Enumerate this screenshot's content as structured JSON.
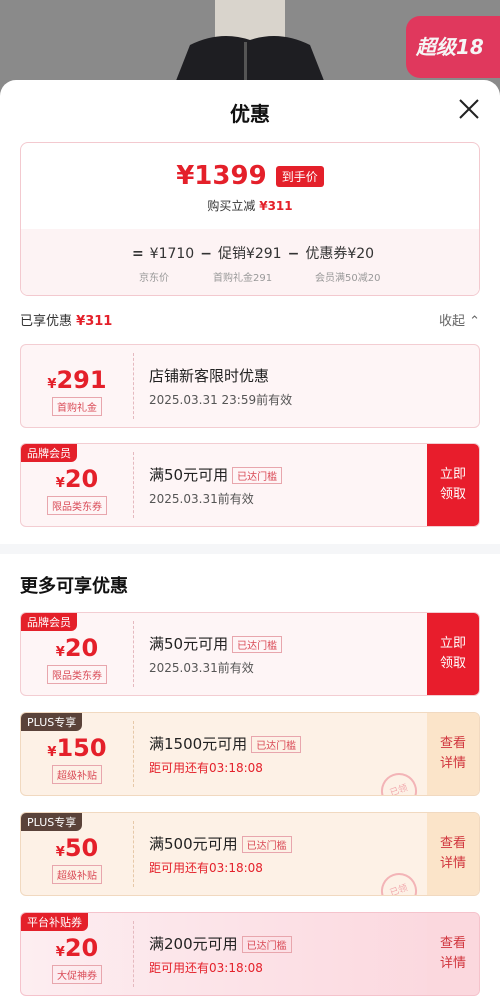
{
  "banner": {
    "badge_text": "超级18"
  },
  "sheet": {
    "title": "优惠",
    "close_icon": "close-icon"
  },
  "summary": {
    "final_price": "¥1399",
    "final_tag": "到手价",
    "save_text": "购买立减",
    "save_amount": "¥311",
    "equation": {
      "base_price": "¥1710",
      "promo": "促销¥291",
      "coupon": "优惠券¥20",
      "sub_base": "京东价",
      "sub_promo": "首购礼金291",
      "sub_coupon": "会员满50减20"
    }
  },
  "enjoyed": {
    "label": "已享优惠",
    "amount": "¥311",
    "collapse": "收起"
  },
  "applied_coupons": [
    {
      "amount": "291",
      "amount_label": "首购礼金",
      "desc": "店铺新客限时优惠",
      "date": "2025.03.31 23:59前有效"
    },
    {
      "corner_tag": "品牌会员",
      "amount": "20",
      "amount_label": "限品类东券",
      "desc": "满50元可用",
      "tag": "已达门槛",
      "date": "2025.03.31前有效",
      "action": "立即领取"
    }
  ],
  "more": {
    "title": "更多可享优惠",
    "coupons": [
      {
        "corner_tag": "品牌会员",
        "amount": "20",
        "amount_label": "限品类东券",
        "desc": "满50元可用",
        "tag": "已达门槛",
        "date": "2025.03.31前有效",
        "action": "立即领取"
      },
      {
        "corner_tag": "PLUS专享",
        "amount": "150",
        "amount_label": "超级补贴",
        "desc": "满1500元可用",
        "tag": "已达门槛",
        "countdown": "距可用还有03:18:08",
        "action": "查看详情",
        "stamp": "已领"
      },
      {
        "corner_tag": "PLUS专享",
        "amount": "50",
        "amount_label": "超级补贴",
        "desc": "满500元可用",
        "tag": "已达门槛",
        "countdown": "距可用还有03:18:08",
        "action": "查看详情",
        "stamp": "已领"
      },
      {
        "corner_tag": "平台补贴券",
        "amount": "20",
        "amount_label": "大促神券",
        "desc": "满200元可用",
        "tag": "已达门槛",
        "countdown": "距可用还有03:18:08",
        "action": "查看详情"
      }
    ]
  },
  "colors": {
    "accent": "#e4202a",
    "plus": "#5a4239"
  }
}
